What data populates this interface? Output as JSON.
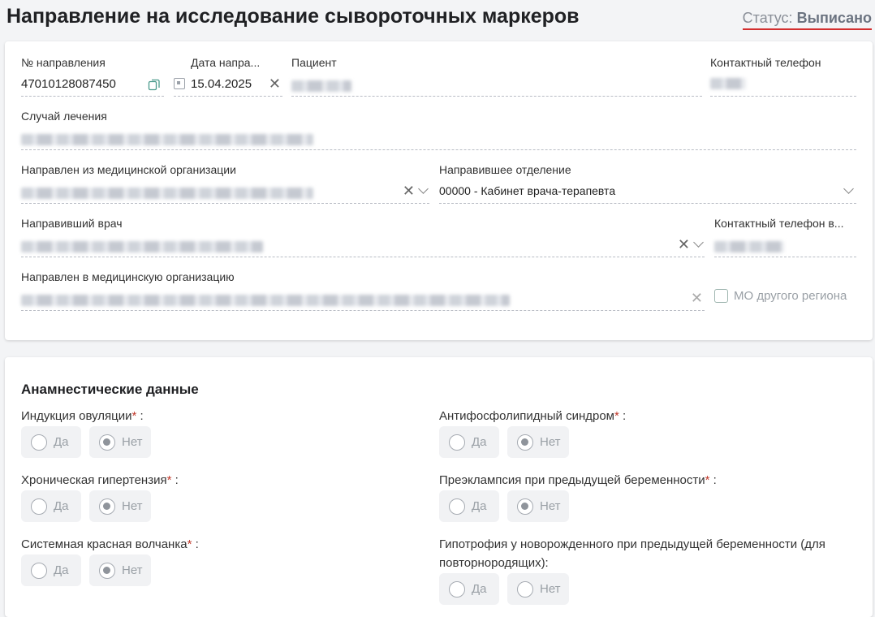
{
  "header": {
    "title": "Направление на исследование сывороточных маркеров",
    "status_label": "Статус:",
    "status_value": "Выписано",
    "status_underline_color": "#d32f2f"
  },
  "referral": {
    "number_label": "№ направления",
    "number_value": "47010128087450",
    "date_label": "Дата напра...",
    "date_value": "15.04.2025",
    "patient_label": "Пациент",
    "contact_phone_label": "Контактный телефон",
    "treatment_case_label": "Случай лечения",
    "from_org_label": "Направлен из медицинской организации",
    "department_label": "Направившее отделение",
    "department_value": "00000 - Кабинет врача-терапевта",
    "doctor_label": "Направивший врач",
    "doctor_phone_label": "Контактный телефон в...",
    "to_org_label": "Направлен в медицинскую организацию",
    "other_region_label": "МО другого региона"
  },
  "anamnesis": {
    "title": "Анамнестические данные",
    "yes_label": "Да",
    "no_label": "Нет",
    "questions": [
      {
        "label": "Индукция овуляции",
        "required": true,
        "selected": "no"
      },
      {
        "label": "Антифосфолипидный синдром",
        "required": true,
        "selected": "no"
      },
      {
        "label": "Хроническая гипертензия",
        "required": true,
        "selected": "no"
      },
      {
        "label": "Преэклампсия при предыдущей беременности",
        "required": true,
        "selected": "no"
      },
      {
        "label": "Системная красная волчанка",
        "required": true,
        "selected": "no"
      },
      {
        "label": "Гипотрофия у новорожденного при предыдущей беременности (для повторнородящих):",
        "required": false,
        "selected": "none"
      }
    ]
  },
  "icons": {
    "copy": "copy-icon",
    "calendar": "calendar-icon",
    "clear": "clear-x-icon",
    "dropdown": "chevron-down-icon"
  }
}
